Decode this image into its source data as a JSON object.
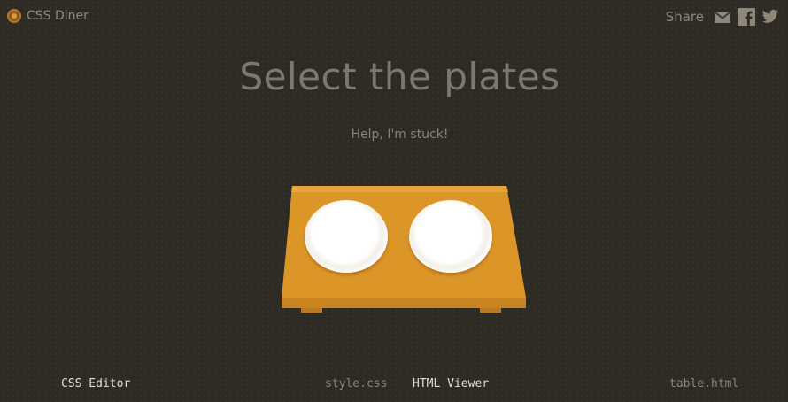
{
  "header": {
    "app_name": "CSS Diner",
    "share_label": "Share",
    "share_icons": [
      "envelope-icon",
      "facebook-icon",
      "twitter-icon"
    ]
  },
  "level": {
    "title": "Select the plates",
    "help_link": "Help, I'm stuck!"
  },
  "scene": {
    "plates_count": 2,
    "table_color": "#dc9628",
    "plate_color": "#ffffff"
  },
  "footer": {
    "css_editor_label": "CSS Editor",
    "css_file": "style.css",
    "html_viewer_label": "HTML Viewer",
    "html_file": "table.html"
  },
  "colors": {
    "background": "#2e2b25",
    "text_muted": "#8f877a",
    "text_bright": "#e4ded2"
  }
}
